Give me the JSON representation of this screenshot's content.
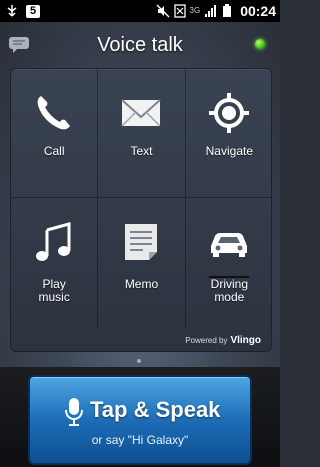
{
  "status_bar": {
    "notification_count": "5",
    "network_type": "3G",
    "time": "00:24"
  },
  "header": {
    "title": "Voice talk",
    "status_color": "#3fbf1a"
  },
  "grid": {
    "items": [
      {
        "label": "Call",
        "icon": "phone-icon"
      },
      {
        "label": "Text",
        "icon": "envelope-icon"
      },
      {
        "label": "Navigate",
        "icon": "crosshair-icon"
      },
      {
        "label": "Play\nmusic",
        "icon": "music-note-icon"
      },
      {
        "label": "Memo",
        "icon": "memo-icon"
      },
      {
        "label": "Driving\nmode",
        "icon": "car-icon"
      }
    ]
  },
  "powered_by": {
    "prefix": "Powered by",
    "brand": "Vlingo"
  },
  "speak": {
    "label": "Tap & Speak",
    "hint": "or say \"Hi Galaxy\""
  },
  "colors": {
    "accent": "#1d6db7",
    "background": "#2b2f38"
  }
}
